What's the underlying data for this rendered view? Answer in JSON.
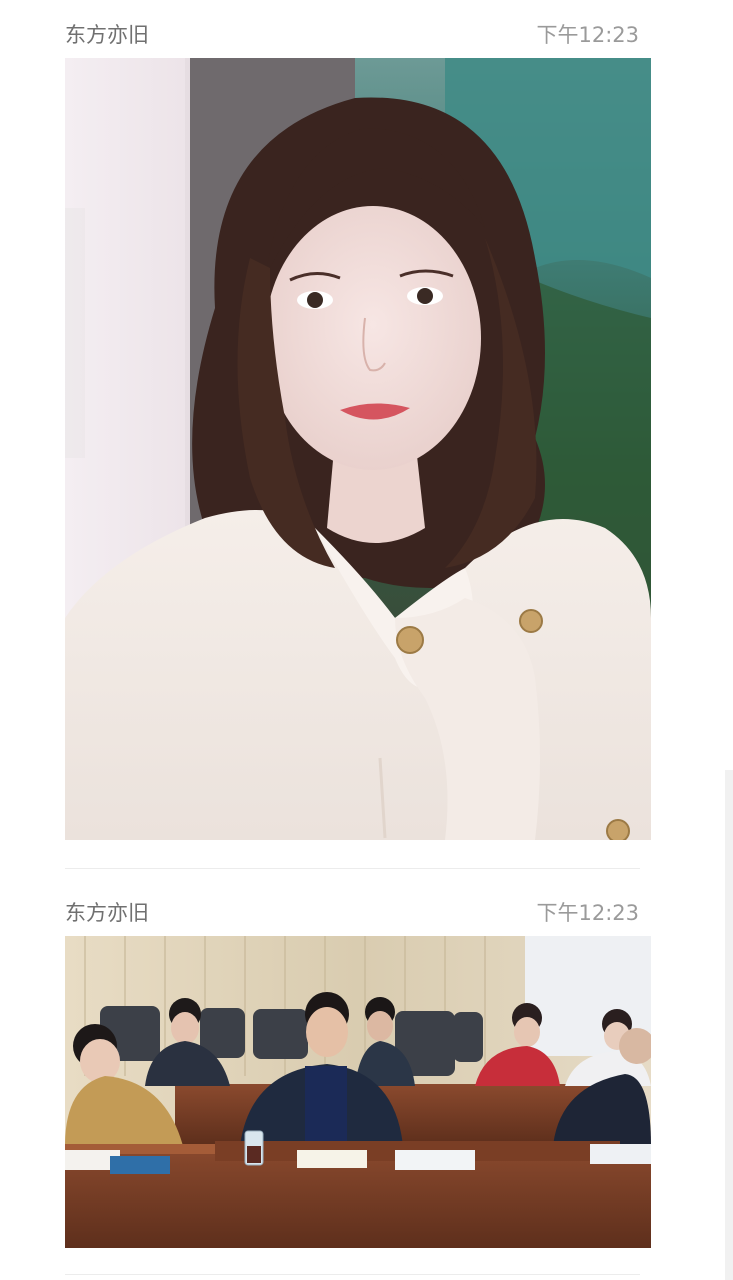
{
  "posts": [
    {
      "author": "东方亦旧",
      "time": "下午12:23",
      "image": "portrait-photo"
    },
    {
      "author": "东方亦旧",
      "time": "下午12:23",
      "image": "meeting-room-photo"
    }
  ]
}
